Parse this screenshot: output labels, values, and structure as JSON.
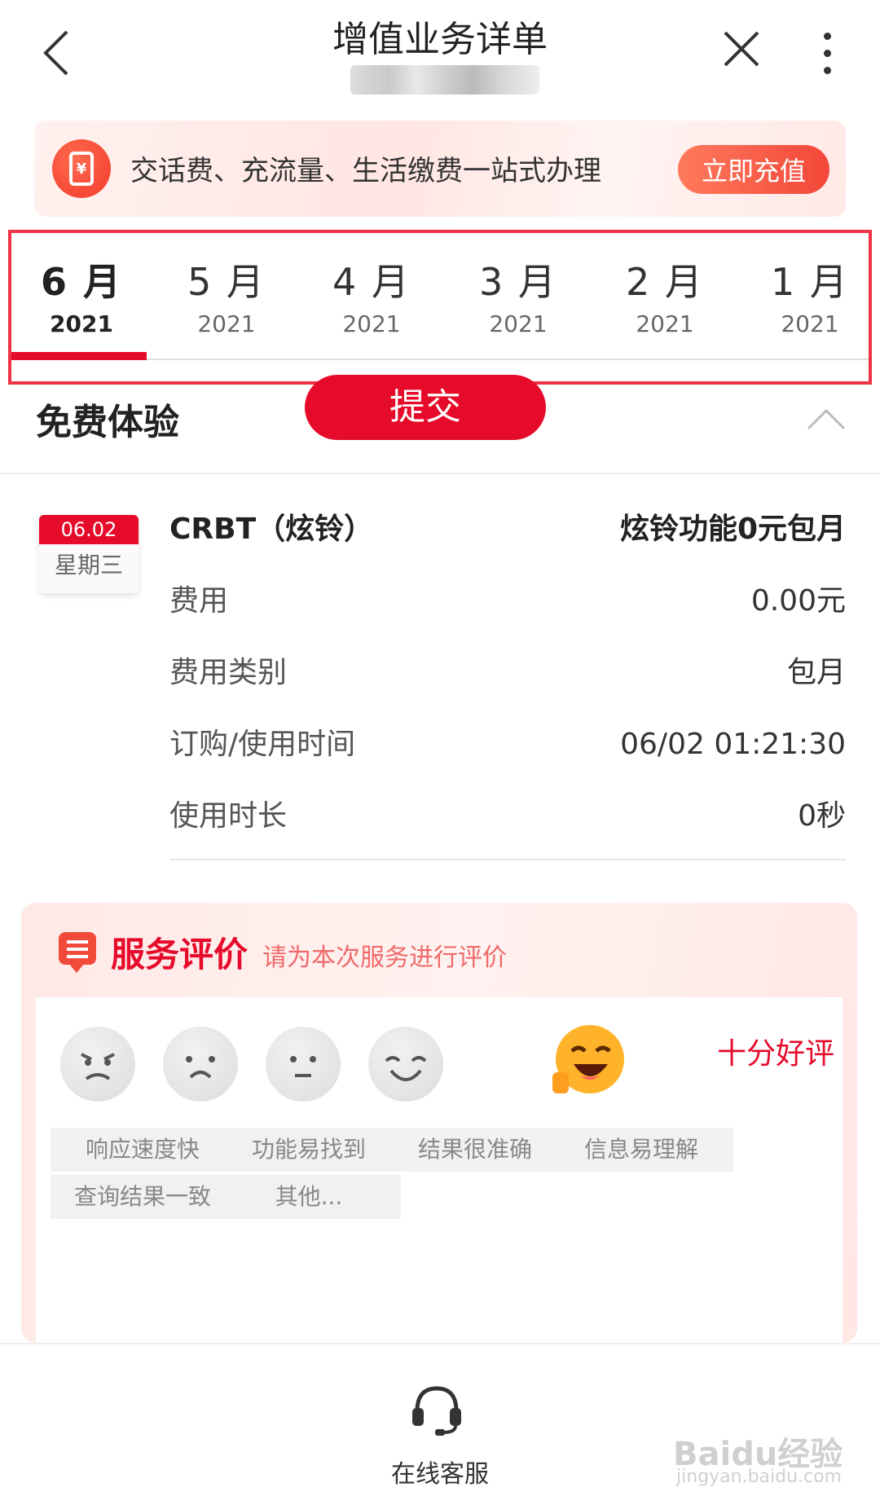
{
  "header": {
    "title": "增值业务详单"
  },
  "promo": {
    "icon_glyph": "¥",
    "text": "交话费、充流量、生活缴费一站式办理",
    "button": "立即充值"
  },
  "tabs": [
    {
      "month": "6 月",
      "year": "2021",
      "active": true
    },
    {
      "month": "5 月",
      "year": "2021"
    },
    {
      "month": "4 月",
      "year": "2021"
    },
    {
      "month": "3 月",
      "year": "2021"
    },
    {
      "month": "2 月",
      "year": "2021"
    },
    {
      "month": "1 月",
      "year": "2021"
    }
  ],
  "section": {
    "title": "免费体验"
  },
  "record": {
    "date": "06.02",
    "weekday": "星期三",
    "service": "CRBT（炫铃）",
    "plan": "炫铃功能0元包月",
    "rows": [
      {
        "label": "费用",
        "value": "0.00元"
      },
      {
        "label": "费用类别",
        "value": "包月"
      },
      {
        "label": "订购/使用时间",
        "value": "06/02 01:21:30"
      },
      {
        "label": "使用时长",
        "value": "0秒"
      }
    ]
  },
  "rating": {
    "title": "服务评价",
    "subtitle": "请为本次服务进行评价",
    "selected_label": "十分好评",
    "tags": [
      "响应速度快",
      "功能易找到",
      "结果很准确",
      "信息易理解",
      "查询结果一致",
      "其他..."
    ],
    "submit": "提交"
  },
  "bottom": {
    "service_label": "在线客服"
  },
  "watermark": {
    "main": "Baidu经验",
    "sub": "jingyan.baidu.com"
  },
  "colors": {
    "accent": "#e60b2a",
    "promo_button": "#f2473a"
  }
}
